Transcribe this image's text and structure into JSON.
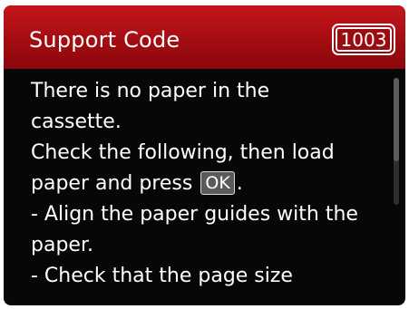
{
  "header": {
    "title": "Support Code",
    "code": "1003"
  },
  "message": {
    "line1": "There is no paper in the",
    "line2": "cassette.",
    "line3": "Check the following, then load",
    "line4_before": "paper and press",
    "ok_key": "OK",
    "line4_after": ".",
    "line5": "- Align the paper guides with the",
    "line6": "paper.",
    "line7": "- Check that the page size"
  },
  "colors": {
    "header_red": "#b01015",
    "background": "#070707",
    "text": "#ffffff"
  },
  "scroll": {
    "position_fraction": 0.0
  }
}
